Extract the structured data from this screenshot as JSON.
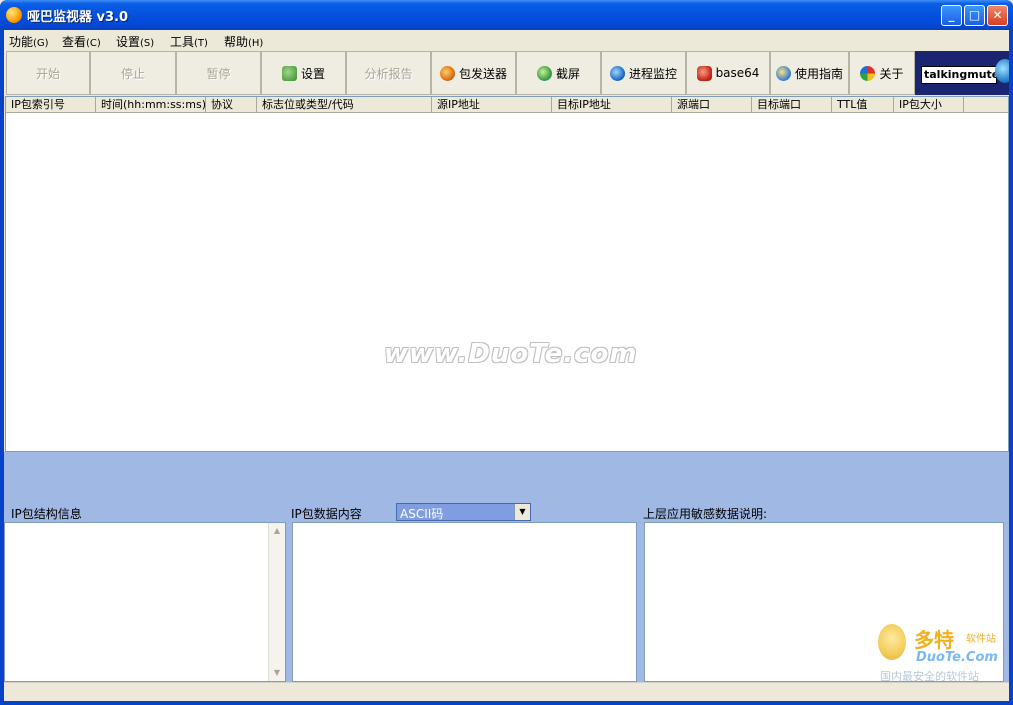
{
  "window": {
    "title": "哑巴监视器  v3.0",
    "controls": [
      "minimize",
      "maximize",
      "close"
    ]
  },
  "menu": [
    {
      "label": "功能",
      "accel": "(G)"
    },
    {
      "label": "查看",
      "accel": "(C)"
    },
    {
      "label": "设置",
      "accel": "(S)"
    },
    {
      "label": "工具",
      "accel": "(T)"
    },
    {
      "label": "帮助",
      "accel": "(H)"
    }
  ],
  "toolbar": {
    "start": "开始",
    "stop": "停止",
    "pause": "暂停",
    "settings": "设置",
    "report": "分析报告",
    "sender": "包发送器",
    "screenshot": "截屏",
    "process": "进程监控",
    "base64": "base64",
    "guide": "使用指南",
    "about": "关于",
    "brand": "talkingmute"
  },
  "table": {
    "columns": [
      "IP包索引号",
      "时间(hh:mm:ss:ms)",
      "协议",
      "标志位或类型/代码",
      "源IP地址",
      "目标IP地址",
      "源端口",
      "目标端口",
      "TTL值",
      "IP包大小"
    ],
    "watermark": "www.DuoTe.com"
  },
  "lower": {
    "struct_label": "IP包结构信息",
    "data_label": "IP包数据内容",
    "encoding_selected": "ASCII码",
    "sensitive_label": "上层应用敏感数据说明:"
  },
  "corner_logo": {
    "name": "多特",
    "site": "软件站",
    "domain": "DuoTe.Com",
    "slogan": "国内最安全的软件站"
  },
  "colors": {
    "titlebar": "#0551dd",
    "lower_panel": "#a0b8e4",
    "combo": "#7f9de0"
  }
}
